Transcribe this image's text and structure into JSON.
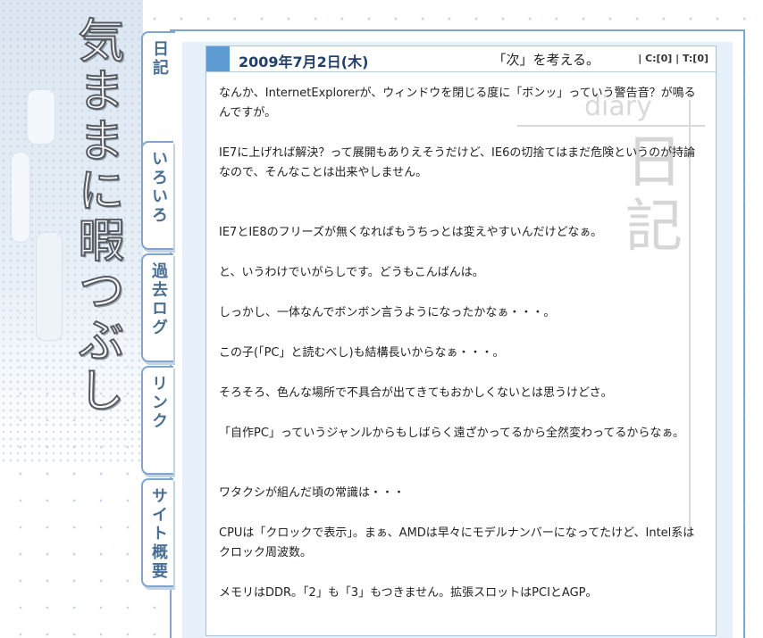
{
  "site": {
    "title": "気ままに暇つぶし"
  },
  "nav": {
    "tabs": [
      {
        "label": "日記"
      },
      {
        "label": "いろいろ"
      },
      {
        "label": "過去ログ"
      },
      {
        "label": "リンク"
      },
      {
        "label": "サイト概要"
      }
    ]
  },
  "post": {
    "date": "2009年7月2日(木)",
    "title": "「次」を考える。",
    "comments_label": "C:[0]",
    "trackbacks_label": "T:[0]",
    "separator": "|",
    "watermark_en": "diary",
    "watermark_jp": "日記",
    "paragraphs": [
      "なんか、InternetExplorerが、ウィンドウを閉じる度に「ボンッ」っていう警告音？が鳴るんですが。",
      "IE7に上げれば解決？って展開もありえそうだけど、IE6の切捨てはまだ危険というのが持論なので、そんなことは出来やしません。",
      "IE7とIE8のフリーズが無くなればもうちっとは変えやすいんだけどなぁ。",
      "と、いうわけでいがらしです。どうもこんばんは。",
      "しっかし、一体なんでボンボン言うようになったかなぁ・・・。",
      "この子(「PC」と読むべし)も結構長いからなぁ・・・。",
      "そろそろ、色んな場所で不具合が出てきてもおかしくないとは思うけどさ。",
      "「自作PC」っていうジャンルからもしばらく遠ざかってるから全然変わってるからなぁ。",
      "ワタクシが組んだ頃の常識は・・・",
      "CPUは「クロックで表示」。まぁ、AMDは早々にモデルナンバーになってたけど、Intel系はクロック周波数。",
      "メモリはDDR。「2」も「3」もつきません。拡張スロットはPCIとAGP。"
    ]
  }
}
